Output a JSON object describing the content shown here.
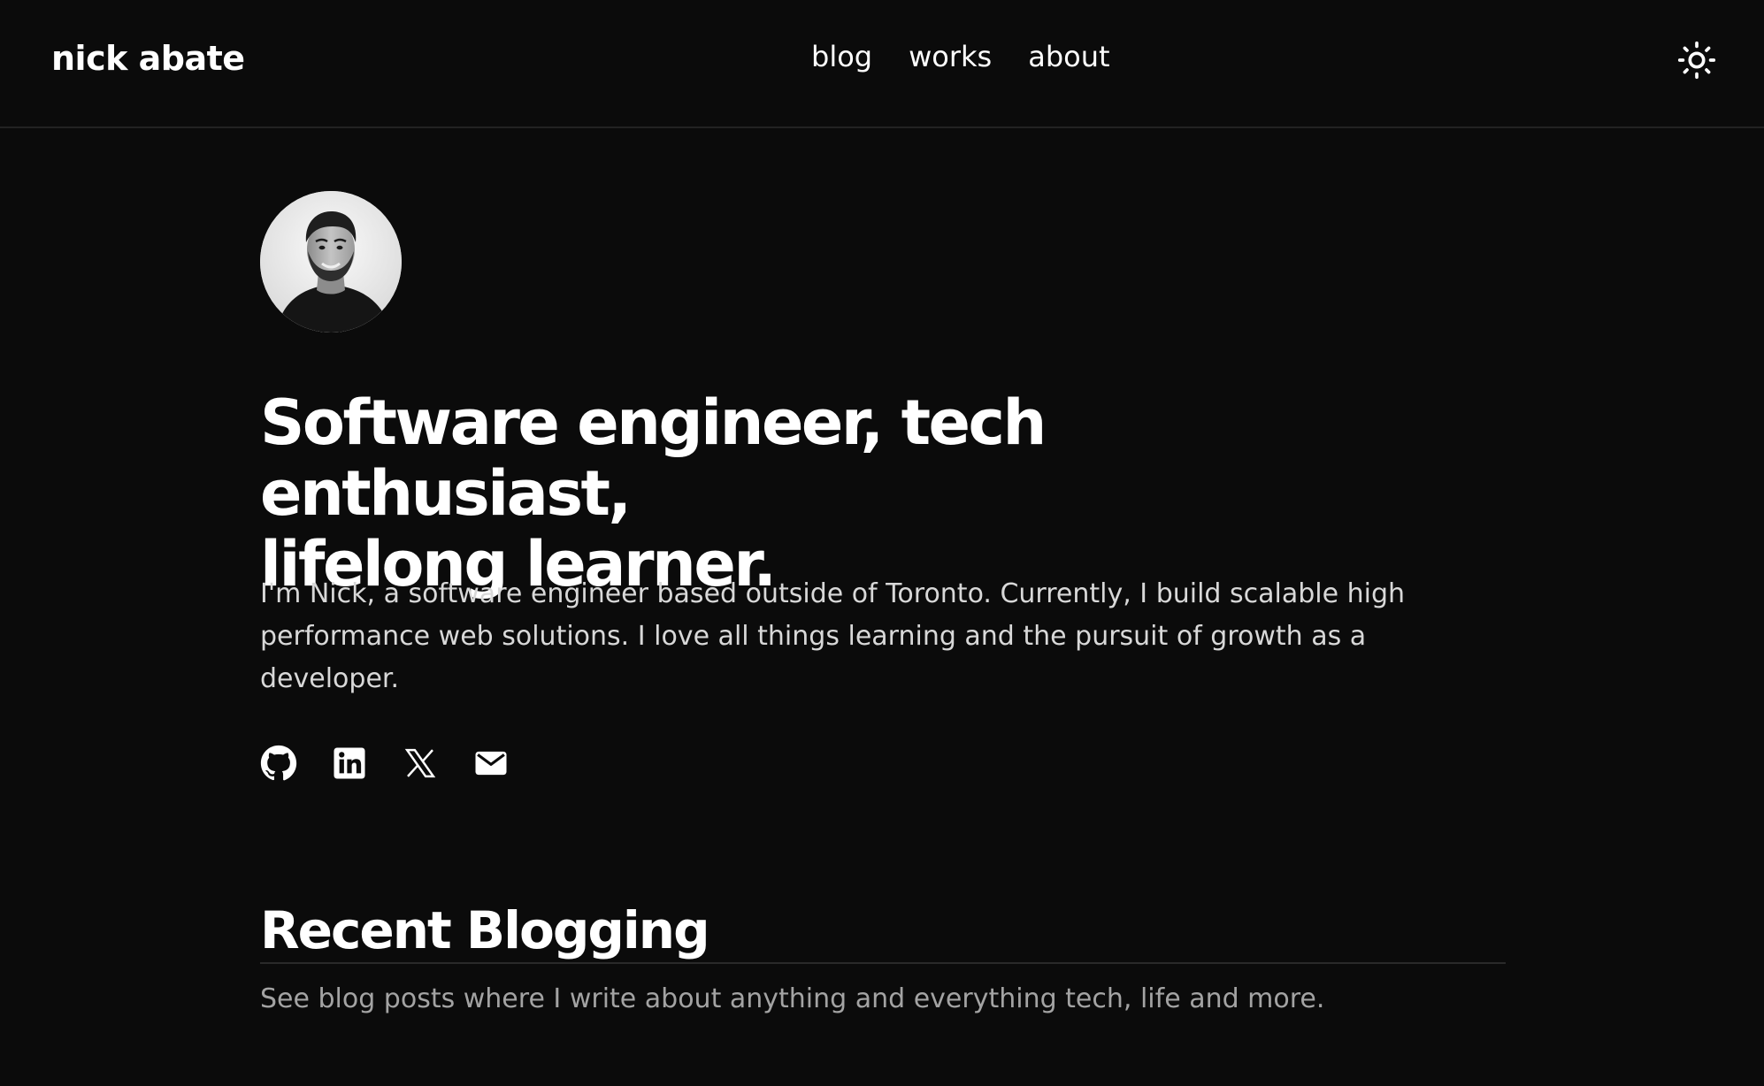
{
  "site": {
    "logo": "nick abate"
  },
  "nav": {
    "items": [
      {
        "label": "blog"
      },
      {
        "label": "works"
      },
      {
        "label": "about"
      }
    ]
  },
  "header": {
    "theme_toggle_icon": "sun-icon"
  },
  "hero": {
    "avatar_icon": "avatar-photo",
    "headline_line1": "Software engineer, tech enthusiast,",
    "headline_line2": "lifelong learner.",
    "intro": "I'm Nick, a software engineer based outside of Toronto. Currently, I build scalable high performance web solutions. I love all things learning and the pursuit of growth as a developer."
  },
  "socials": [
    {
      "icon": "github-icon"
    },
    {
      "icon": "linkedin-icon"
    },
    {
      "icon": "x-icon"
    },
    {
      "icon": "email-icon"
    }
  ],
  "recent": {
    "title": "Recent Blogging",
    "subtitle": "See blog posts where I write about anything and everything tech, life and more."
  },
  "colors": {
    "background": "#0b0b0b",
    "text": "#ffffff",
    "body_text": "#d8d8d8",
    "muted_text": "#a3a3a3",
    "border": "#222222"
  }
}
